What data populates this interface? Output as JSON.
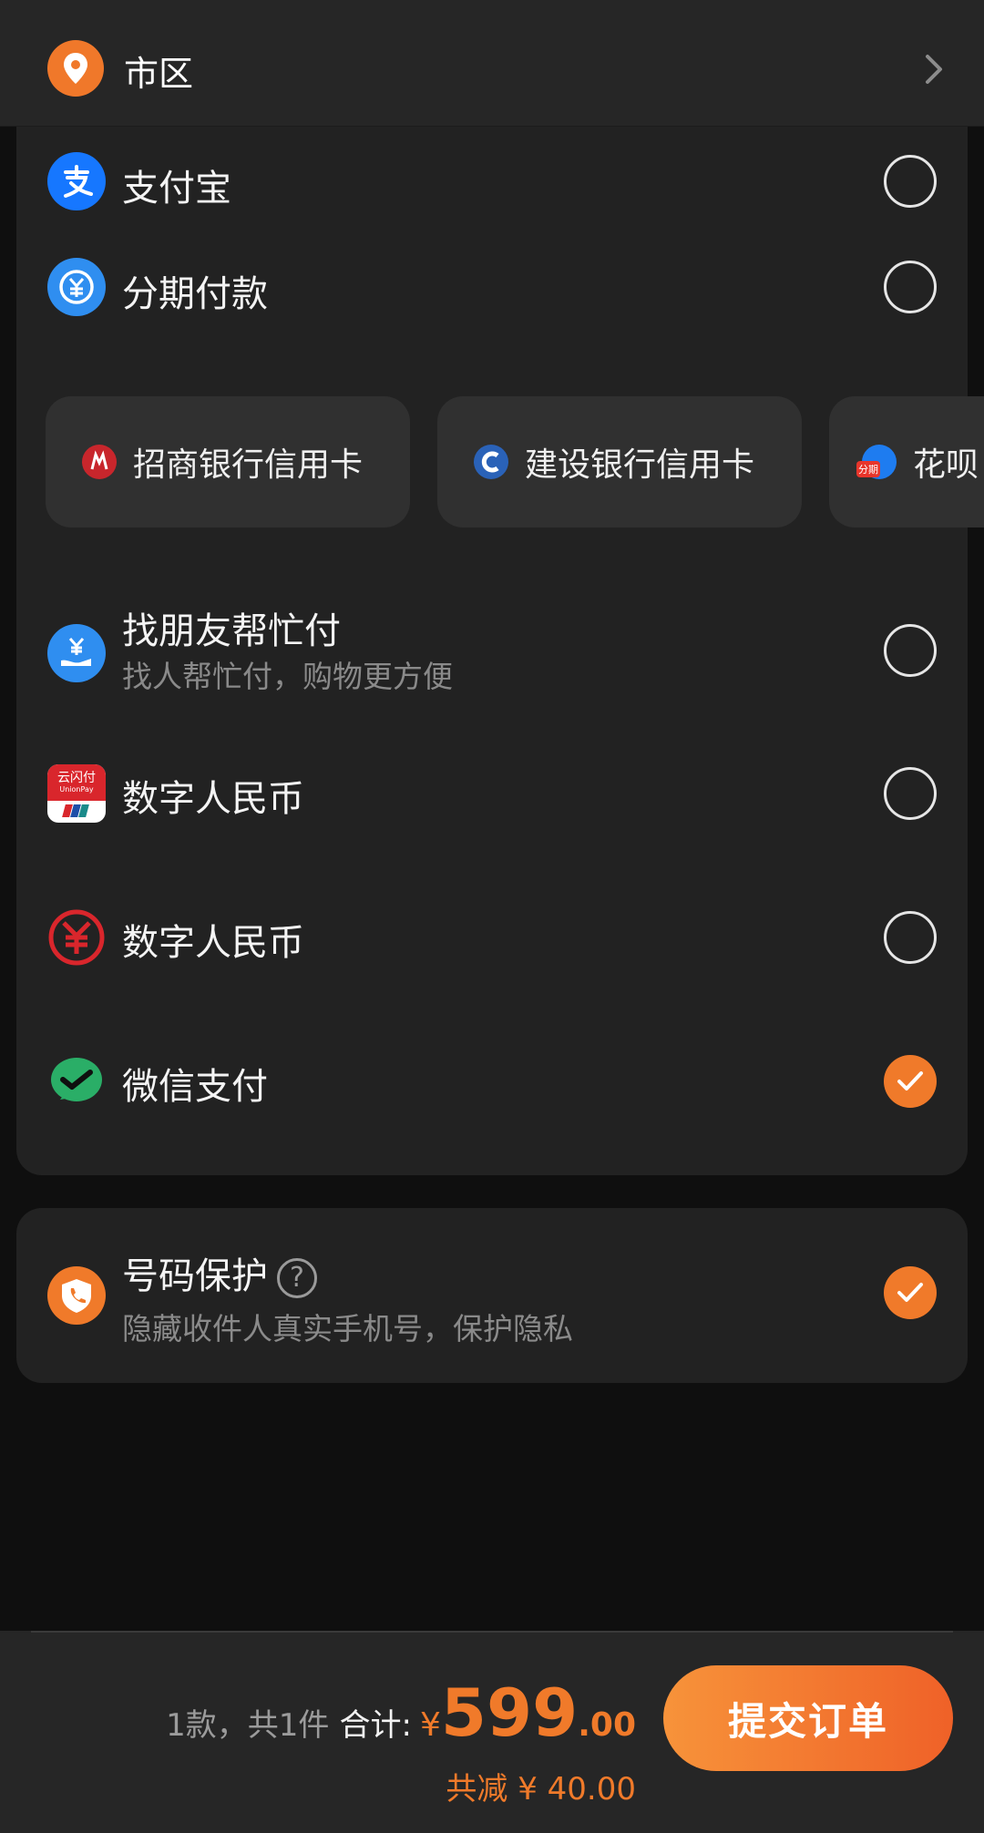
{
  "address": {
    "label": "市区"
  },
  "payment_methods": [
    {
      "id": "alipay",
      "title": "支付宝",
      "icon": "alipay-icon",
      "selected": false
    },
    {
      "id": "installment",
      "title": "分期付款",
      "icon": "installment-icon",
      "selected": false
    },
    {
      "id": "friend",
      "title": "找朋友帮忙付",
      "subtitle": "找人帮忙付，购物更方便",
      "icon": "friend-pay-icon",
      "selected": false
    },
    {
      "id": "unionpay",
      "title": "云闪付",
      "icon": "unionpay-icon",
      "icon_text": "云闪付",
      "icon_subtext": "UnionPay",
      "selected": false
    },
    {
      "id": "ecny",
      "title": "数字人民币",
      "icon": "digital-rmb-icon",
      "selected": false
    },
    {
      "id": "wechat",
      "title": "微信支付",
      "icon": "wechat-pay-icon",
      "selected": true
    }
  ],
  "installment_options": [
    {
      "label": "招商银行信用卡",
      "icon": "cmb-icon",
      "color": "#c8262c"
    },
    {
      "label": "建设银行信用卡",
      "icon": "ccb-icon",
      "color": "#2a62b8"
    },
    {
      "label": "花呗",
      "icon": "huabei-icon",
      "badge": "分期",
      "color": "#1e7cf0"
    }
  ],
  "number_protection": {
    "title": "号码保护",
    "help": "?",
    "subtitle": "隐藏收件人真实手机号，保护隐私",
    "selected": true
  },
  "order_summary": {
    "count": "1款，共1件",
    "total_label": "合计:",
    "currency": "¥",
    "amount_int": "599",
    "amount_dec": ".00",
    "discount": "共减 ¥ 40.00",
    "submit_label": "提交订单"
  },
  "colors": {
    "accent": "#f07a2a",
    "alipay": "#1677ff",
    "wechat": "#2aae67",
    "digital_rmb": "#d9262c",
    "unionpay": "#d9262c"
  }
}
